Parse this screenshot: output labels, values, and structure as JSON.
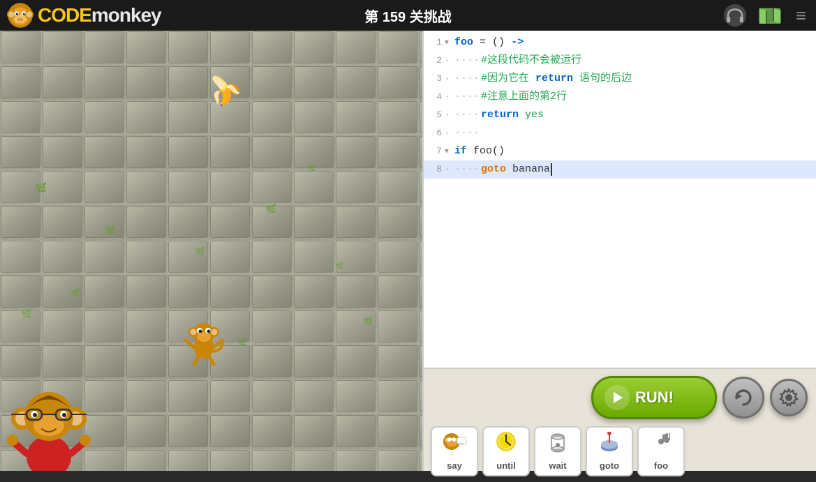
{
  "topbar": {
    "logo_text_code": "CODE",
    "logo_text_monkey": "monkey",
    "challenge_title": "第 159 关挑战",
    "menu_icon": "≡"
  },
  "code_editor": {
    "lines": [
      {
        "num": "1",
        "arrow": "▾",
        "content_type": "func_def",
        "text": "foo = () ->"
      },
      {
        "num": "2",
        "arrow": "·",
        "content_type": "comment",
        "text": "#这段代码不会被运行"
      },
      {
        "num": "3",
        "arrow": "·",
        "content_type": "comment",
        "text": "#因为它在 return 语句的后边"
      },
      {
        "num": "4",
        "arrow": "·",
        "content_type": "comment",
        "text": "#注意上面的第2行"
      },
      {
        "num": "5",
        "arrow": "·",
        "content_type": "return",
        "text": "return yes"
      },
      {
        "num": "6",
        "arrow": "·",
        "content_type": "empty",
        "text": ""
      },
      {
        "num": "7",
        "arrow": "▾",
        "content_type": "if_stmt",
        "text": "if foo()"
      },
      {
        "num": "8",
        "arrow": "·",
        "content_type": "goto",
        "text": "goto banana"
      }
    ]
  },
  "buttons": {
    "run_label": "RUN!",
    "reset_title": "重置",
    "settings_title": "设置"
  },
  "blocks": [
    {
      "id": "say",
      "label": "say",
      "icon": "🐵"
    },
    {
      "id": "until",
      "label": "until",
      "icon": "💡"
    },
    {
      "id": "wait",
      "label": "wait",
      "icon": "⏰"
    },
    {
      "id": "goto",
      "label": "goto",
      "icon": "🎵"
    },
    {
      "id": "foo",
      "label": "foo",
      "icon": "🐒"
    }
  ]
}
